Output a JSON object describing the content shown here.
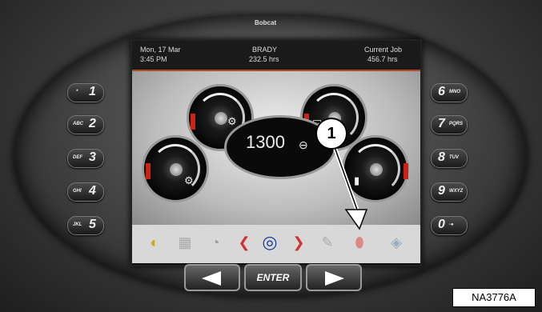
{
  "brand": "Bobcat",
  "header": {
    "date": "Mon, 17 Mar",
    "time": "3:45 PM",
    "operator": "BRADY",
    "hours": "232.5 hrs",
    "job_label": "Current Job",
    "job_hours": "456.7 hrs"
  },
  "center_display": {
    "rpm": "1300",
    "icon": "rpm-icon"
  },
  "gauges": [
    {
      "name": "engine-temp-gauge",
      "icon": "engine-icon"
    },
    {
      "name": "battery-gauge",
      "icon": "battery-icon"
    },
    {
      "name": "hydraulic-temp-gauge",
      "icon": "hydraulic-icon"
    },
    {
      "name": "fuel-gauge",
      "icon": "fuel-icon"
    }
  ],
  "icon_bar": [
    "warning-icon",
    "grid-icon",
    "clock-icon",
    "nav-left-icon",
    "select-icon",
    "nav-right-icon",
    "wrench-icon",
    "fuel-pump-icon",
    "settings-icon"
  ],
  "left_keys": [
    {
      "small": "*",
      "big": "1"
    },
    {
      "small": "ABC",
      "big": "2"
    },
    {
      "small": "DEF",
      "big": "3"
    },
    {
      "small": "GHI",
      "big": "4"
    },
    {
      "small": "JKL",
      "big": "5"
    }
  ],
  "right_keys": [
    {
      "big": "6",
      "small": "MNO"
    },
    {
      "big": "7",
      "small": "PQRS"
    },
    {
      "big": "8",
      "small": "TUV"
    },
    {
      "big": "9",
      "small": "WXYZ"
    },
    {
      "big": "0",
      "small": "-●"
    }
  ],
  "nav": {
    "enter_label": "ENTER"
  },
  "callout": "1",
  "figure_label": "NA3776A",
  "colors": {
    "accent": "#b24a26",
    "gauge_red": "#cc2211",
    "key_bg": "#2a2a2a"
  }
}
